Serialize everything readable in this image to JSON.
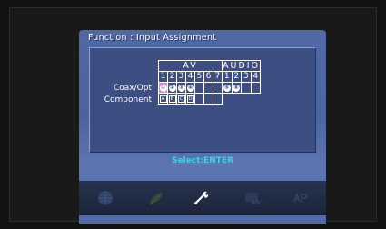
{
  "menu": {
    "title": "Function : Input Assignment",
    "group_av": "AV",
    "group_audio": "AUDIO",
    "av_numbers": [
      "1",
      "2",
      "3",
      "4",
      "5",
      "6",
      "7"
    ],
    "audio_numbers": [
      "1",
      "2",
      "3",
      "4"
    ],
    "row_coax_opt": "Coax/Opt",
    "row_component": "Component",
    "coax_marks": [
      "①",
      "②",
      "③",
      "④",
      "",
      "",
      "",
      "⑤",
      "⑥",
      "",
      ""
    ],
    "component_marks": [
      "A",
      "B",
      "C",
      "D",
      "",
      "",
      "",
      "",
      "",
      "",
      ""
    ],
    "hint": "Select:ENTER"
  },
  "icon_bar": {
    "items": [
      "globe-icon",
      "leaf-icon",
      "wrench-icon",
      "abc-icon",
      "text-icon"
    ]
  },
  "colors": {
    "selected": "#e87adf",
    "hint": "#39d4e8",
    "osd_blue": "#4a64a0"
  }
}
